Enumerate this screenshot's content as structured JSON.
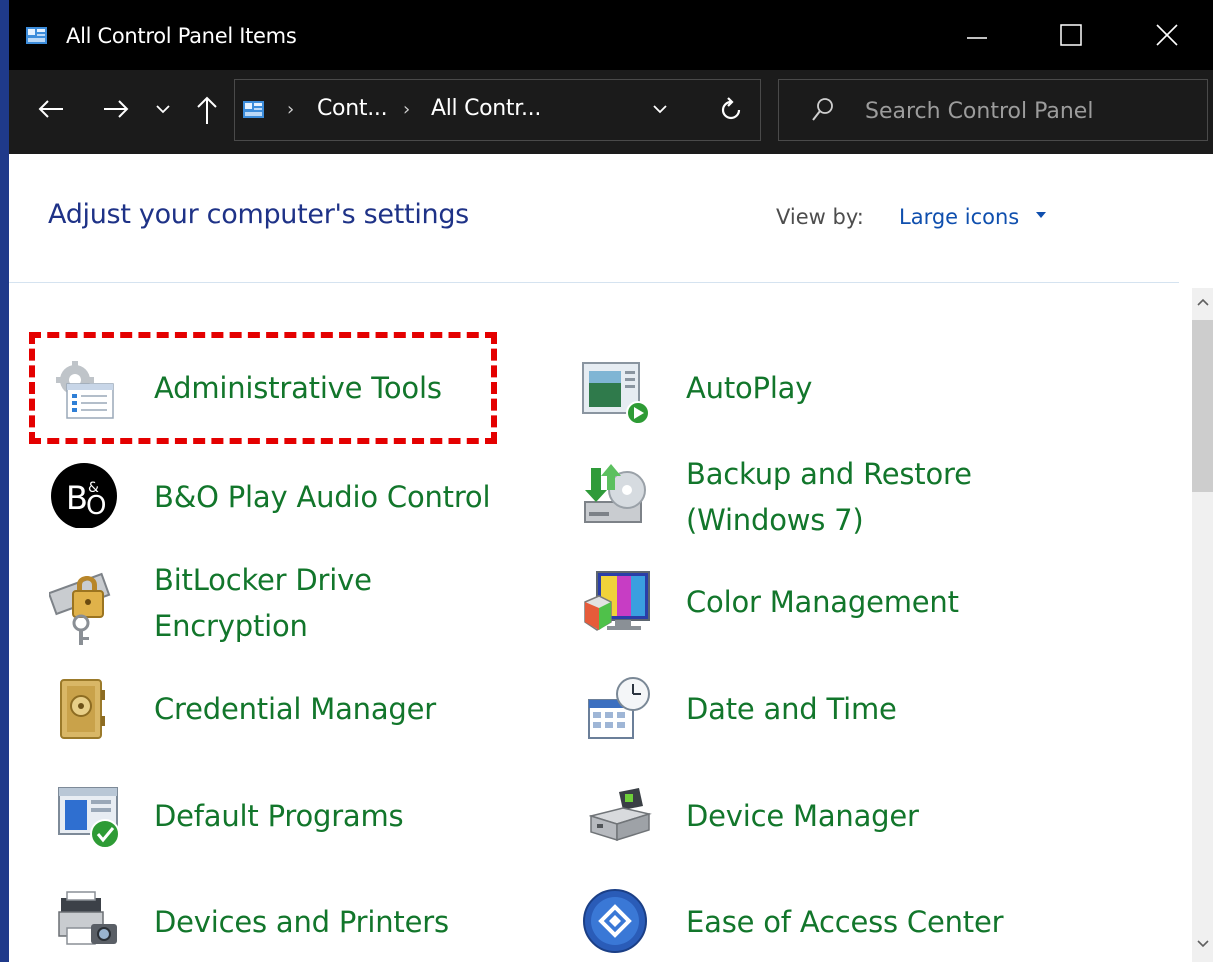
{
  "window": {
    "title": "All Control Panel Items"
  },
  "address_bar": {
    "crumbs": [
      "Cont...",
      "All Contr..."
    ]
  },
  "search": {
    "placeholder": "Search Control Panel"
  },
  "header": {
    "title": "Adjust your computer's settings",
    "view_by_label": "View by:",
    "view_by_value": "Large icons"
  },
  "items": [
    {
      "label": "Administrative Tools",
      "icon": "admin-tools-icon",
      "highlighted": true
    },
    {
      "label": "AutoPlay",
      "icon": "autoplay-icon"
    },
    {
      "label": "B&O Play Audio Control",
      "icon": "bo-play-icon"
    },
    {
      "label": "Backup and Restore",
      "label2": "(Windows 7)",
      "icon": "backup-restore-icon"
    },
    {
      "label": "BitLocker Drive",
      "label2": "Encryption",
      "icon": "bitlocker-icon"
    },
    {
      "label": "Color Management",
      "icon": "color-management-icon"
    },
    {
      "label": "Credential Manager",
      "icon": "credential-manager-icon"
    },
    {
      "label": "Date and Time",
      "icon": "date-time-icon"
    },
    {
      "label": "Default Programs",
      "icon": "default-programs-icon"
    },
    {
      "label": "Device Manager",
      "icon": "device-manager-icon"
    },
    {
      "label": "Devices and Printers",
      "icon": "devices-printers-icon"
    },
    {
      "label": "Ease of Access Center",
      "icon": "ease-of-access-icon"
    }
  ],
  "colors": {
    "item_text": "#12762b",
    "header_text": "#1e3287",
    "highlight": "#e40000"
  }
}
